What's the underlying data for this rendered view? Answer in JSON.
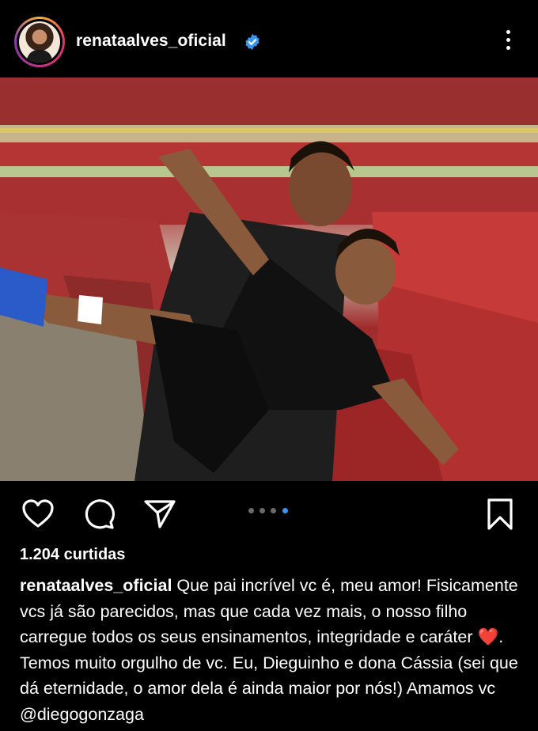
{
  "header": {
    "username": "renataalves_oficial",
    "verified_icon": "verified-badge-icon",
    "more_icon": "more-options-icon",
    "verified_color": "#3897f0"
  },
  "post": {
    "image_alt": "Father and son at stadium",
    "carousel": {
      "total": 4,
      "active": 4
    },
    "likes": "1.204 curtidas",
    "caption": {
      "username": "renataalves_oficial",
      "text_before_emoji": " Que pai incrível vc é, meu amor! Fisicamente vcs já são parecidos, mas que cada vez mais, o nosso filho carregue todos os seus ensinamentos, integridade e caráter ",
      "emoji": "❤️",
      "text_after_emoji": ". Temos muito orgulho de vc. Eu, Dieguinho e dona Cássia (sei que dá eternidade, o amor dela é ainda maior por nós!) Amamos vc @diegogonzaga"
    }
  },
  "actions": {
    "like_icon": "heart-icon",
    "comment_icon": "comment-icon",
    "share_icon": "send-icon",
    "save_icon": "bookmark-icon"
  },
  "colors": {
    "background": "#000000",
    "text": "#ffffff",
    "dot_active": "#3897f0",
    "dot_inactive": "#6b6b6b"
  }
}
